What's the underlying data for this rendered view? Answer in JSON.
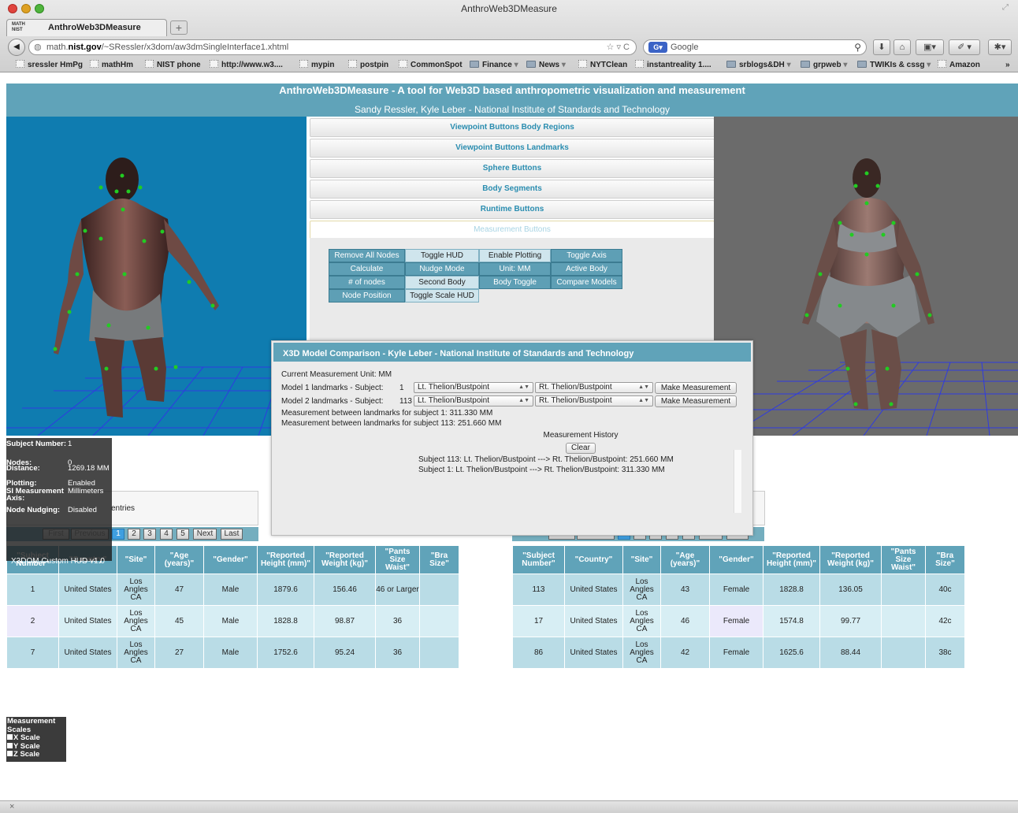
{
  "window": {
    "title": "AnthroWeb3DMeasure"
  },
  "tab": {
    "label": "AnthroWeb3DMeasure",
    "favicon_text": "MATH NIST"
  },
  "nav": {
    "url_host": "math.nist.gov",
    "url_pre": "math.",
    "url_mid": "nist.gov",
    "url_post": "/~SRessler/x3dom/aw3dmSingleInterface1.xhtml",
    "search_placeholder": "Google"
  },
  "bookmarks": [
    {
      "label": "sressler HmPg",
      "icon": "page-icon"
    },
    {
      "label": "mathHm",
      "icon": "nist-icon"
    },
    {
      "label": "NIST phone",
      "icon": "nist-icon"
    },
    {
      "label": "http://www.w3....",
      "icon": "star-icon"
    },
    {
      "label": "mypin",
      "icon": "x-icon"
    },
    {
      "label": "postpin",
      "icon": "page-icon"
    },
    {
      "label": "CommonSpot",
      "icon": "page-icon"
    },
    {
      "label": "Finance",
      "icon": "folder-icon"
    },
    {
      "label": "News",
      "icon": "folder-icon"
    },
    {
      "label": "NYTClean",
      "icon": "page-icon"
    },
    {
      "label": "instantreality 1....",
      "icon": "ir-icon"
    },
    {
      "label": "srblogs&DH",
      "icon": "folder-icon"
    },
    {
      "label": "grpweb",
      "icon": "folder-icon"
    },
    {
      "label": "TWIKIs & cssg",
      "icon": "folder-icon"
    },
    {
      "label": "Amazon",
      "icon": "amazon-icon"
    }
  ],
  "header": {
    "title": "AnthroWeb3DMeasure - A tool for Web3D based anthropometric visualization and measurement",
    "subtitle": "Sandy Ressler, Kyle Leber - National Institute of Standards and Technology"
  },
  "accordion": [
    "Viewpoint Buttons Body Regions",
    "Viewpoint Buttons Landmarks",
    "Sphere Buttons",
    "Body Segments",
    "Runtime Buttons",
    "Measurement Buttons"
  ],
  "measurement_buttons": [
    "Remove All Nodes",
    "Toggle HUD",
    "Enable Plotting",
    "Toggle Axis",
    "Calculate",
    "Nudge Mode",
    "Unit: MM",
    "Active Body",
    "# of nodes",
    "Second Body",
    "Body Toggle",
    "Compare Models",
    "Node Position",
    "Toggle Scale HUD"
  ],
  "dialog": {
    "title": "X3D Model Comparison - Kyle Leber - National Institute of Standards and Technology",
    "unit_line": "Current Measurement Unit: MM",
    "model1_label": "Model 1 landmarks - Subject:",
    "model1_subject": "1",
    "model2_label": "Model 2 landmarks - Subject:",
    "model2_subject": "113",
    "sel_left": "Lt. Thelion/Bustpoint",
    "sel_right": "Rt. Thelion/Bustpoint",
    "make_btn": "Make Measurement",
    "result1": "Measurement between landmarks for subject 1: 311.330 MM",
    "result2": "Measurement between landmarks for subject 113: 251.660 MM",
    "history_label": "Measurement History",
    "clear_btn": "Clear",
    "history": [
      "Subject 113: Lt. Thelion/Bustpoint ---> Rt. Thelion/Bustpoint: 251.660 MM",
      "Subject 1: Lt. Thelion/Bustpoint ---> Rt. Thelion/Bustpoint: 311.330 MM"
    ]
  },
  "hud": {
    "rows": [
      {
        "k": "Subject Number:",
        "v": "1"
      },
      {
        "k": "Nodes:",
        "v": "0"
      },
      {
        "k": "Distance:",
        "v": "1269.18 MM"
      },
      {
        "k": "Plotting:",
        "v": "Enabled"
      },
      {
        "k": "SI Measurement Axis:",
        "v": "Millimeters"
      },
      {
        "k": "Node Nudging:",
        "v": "Disabled"
      }
    ],
    "version": "X3DOM Custom HUD v1.0",
    "entries_frag": "entries"
  },
  "pager": {
    "first": "First",
    "previous": "Previous",
    "pages": [
      "1",
      "2",
      "3",
      "4",
      "5"
    ],
    "next": "Next",
    "last": "Last"
  },
  "left_table": {
    "headers": [
      "\"Subject Number\"",
      "\"Country\"",
      "\"Site\"",
      "\"Age (years)\"",
      "\"Gender\"",
      "\"Reported Height (mm)\"",
      "\"Reported Weight (kg)\"",
      "\"Pants Size Waist\"",
      "\"Bra Size\""
    ],
    "rows": [
      [
        "1",
        "United States",
        "Los Angles CA",
        "47",
        "Male",
        "1879.6",
        "156.46",
        "46 or Larger",
        ""
      ],
      [
        "2",
        "United States",
        "Los Angles CA",
        "45",
        "Male",
        "1828.8",
        "98.87",
        "36",
        ""
      ],
      [
        "7",
        "United States",
        "Los Angles CA",
        "27",
        "Male",
        "1752.6",
        "95.24",
        "36",
        ""
      ]
    ]
  },
  "right_table": {
    "headers": [
      "\"Subject Number\"",
      "\"Country\"",
      "\"Site\"",
      "\"Age (years)\"",
      "\"Gender\"",
      "\"Reported Height (mm)\"",
      "\"Reported Weight (kg)\"",
      "\"Pants Size Waist\"",
      "\"Bra Size\""
    ],
    "rows": [
      [
        "113",
        "United States",
        "Los Angles CA",
        "43",
        "Female",
        "1828.8",
        "136.05",
        "",
        "40c"
      ],
      [
        "17",
        "United States",
        "Los Angles CA",
        "46",
        "Female",
        "1574.8",
        "99.77",
        "",
        "42c"
      ],
      [
        "86",
        "United States",
        "Los Angles CA",
        "42",
        "Female",
        "1625.6",
        "88.44",
        "",
        "38c"
      ]
    ]
  },
  "scales": {
    "title": "Measurement Scales",
    "x": "X Scale",
    "y": "Y Scale",
    "z": "Z Scale"
  },
  "status": {
    "close_glyph": "×"
  },
  "colors": {
    "accent": "#60a3b9",
    "left_view": "#0f7cb0",
    "right_view": "#6b6b6b",
    "landmark": "#22cc22"
  }
}
